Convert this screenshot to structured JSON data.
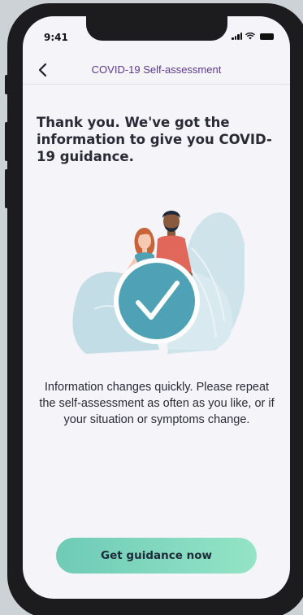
{
  "status_bar": {
    "time": "9:41",
    "icons": [
      "cellular-signal-icon",
      "wifi-icon",
      "battery-icon"
    ]
  },
  "nav": {
    "title": "COVID-19 Self-assessment",
    "back_icon": "chevron-left-icon"
  },
  "content": {
    "headline": "Thank you. We've got the information to give you COVID-19 guidance.",
    "illustration_icon": "checkmark-circle-icon",
    "info_text": "Information changes quickly. Please repeat the self-assessment as often as you like, or if your situation or symptoms change."
  },
  "cta": {
    "label": "Get guidance now"
  },
  "colors": {
    "accent": "#5b3a8c",
    "button_gradient_start": "#6ecbb6",
    "button_gradient_end": "#94e4c6",
    "check_circle": "#4fa2b5",
    "background": "#f5f4f9"
  }
}
